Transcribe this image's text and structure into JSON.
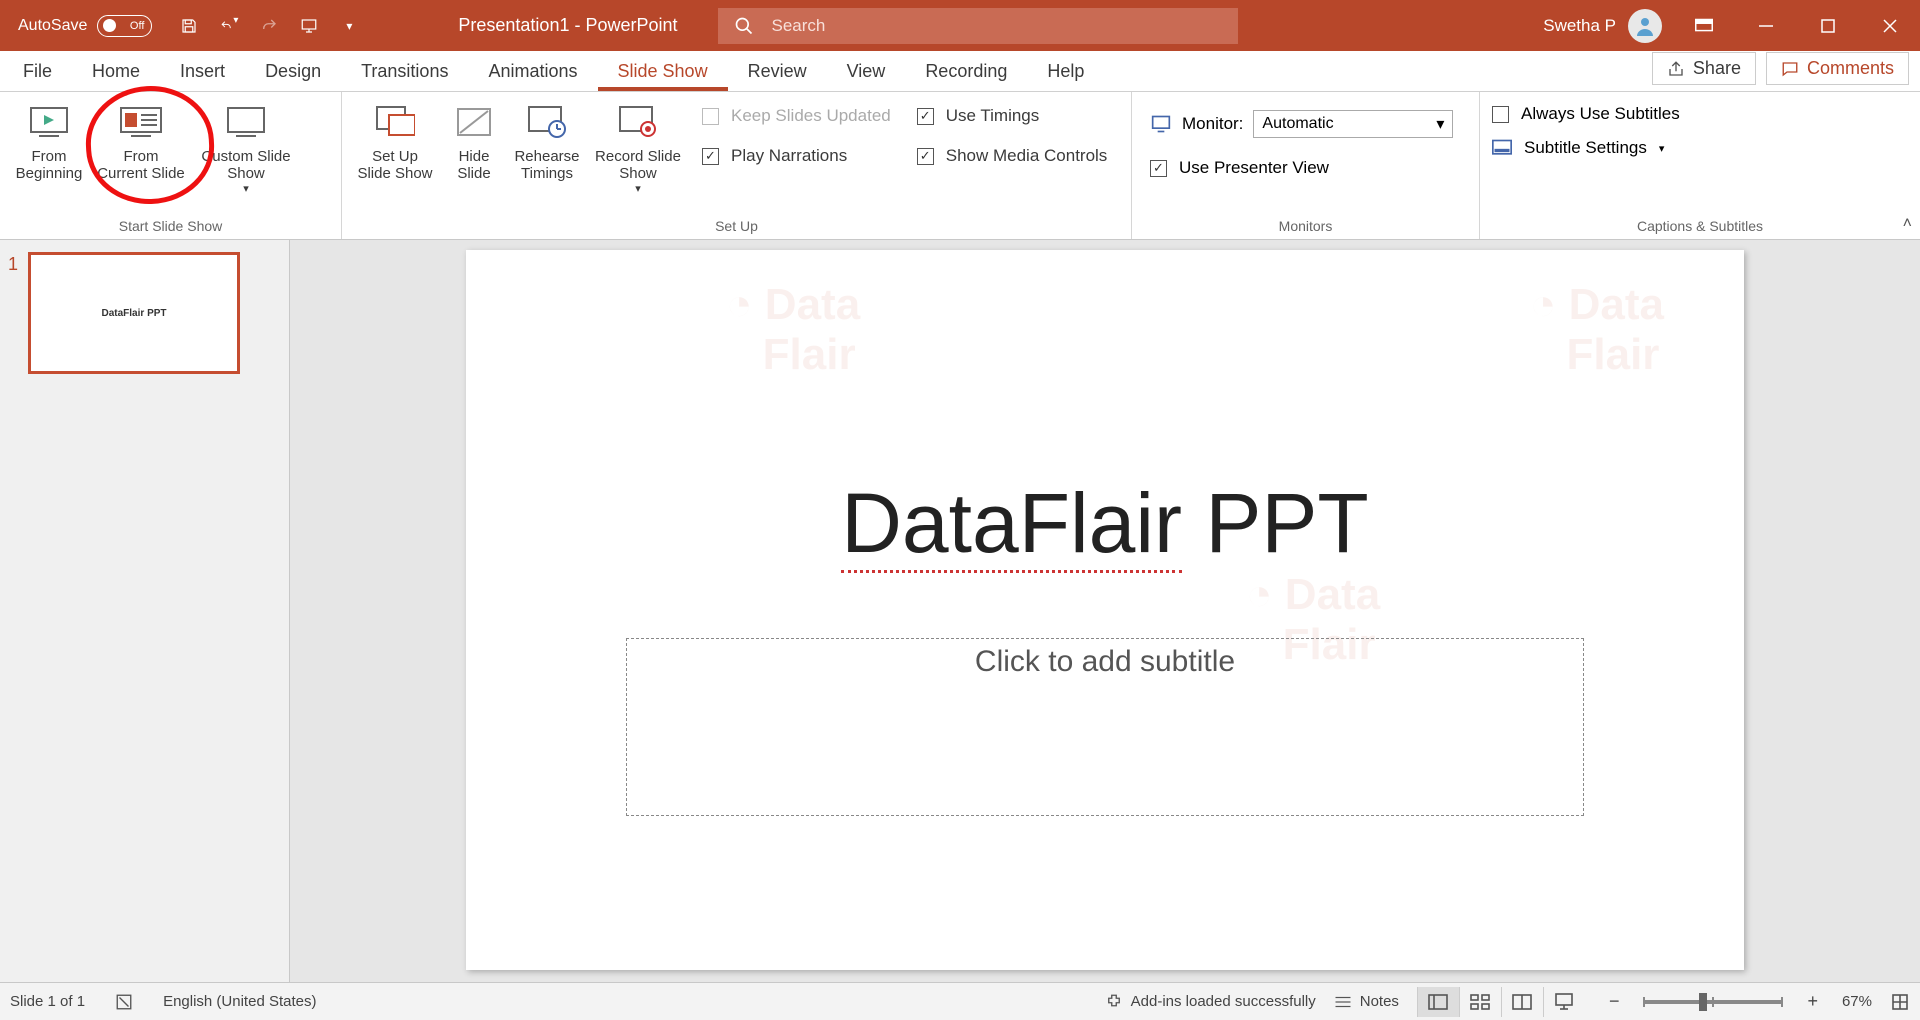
{
  "titlebar": {
    "autosave_label": "AutoSave",
    "autosave_state": "Off",
    "doc_title": "Presentation1  -  PowerPoint",
    "search_placeholder": "Search",
    "user_name": "Swetha P"
  },
  "menu": {
    "tabs": [
      "File",
      "Home",
      "Insert",
      "Design",
      "Transitions",
      "Animations",
      "Slide Show",
      "Review",
      "View",
      "Recording",
      "Help"
    ],
    "active_index": 6,
    "share": "Share",
    "comments": "Comments"
  },
  "ribbon": {
    "start_group": {
      "label": "Start Slide Show",
      "from_beginning": "From\nBeginning",
      "from_current": "From\nCurrent Slide",
      "custom_show": "Custom Slide\nShow"
    },
    "setup_group": {
      "label": "Set Up",
      "setup": "Set Up\nSlide Show",
      "hide": "Hide\nSlide",
      "rehearse": "Rehearse\nTimings",
      "record": "Record Slide\nShow",
      "keep_updated": "Keep Slides Updated",
      "play_narrations": "Play Narrations",
      "use_timings": "Use Timings",
      "show_media": "Show Media Controls"
    },
    "monitors_group": {
      "label": "Monitors",
      "monitor_label": "Monitor:",
      "monitor_value": "Automatic",
      "presenter_view": "Use Presenter View"
    },
    "captions_group": {
      "label": "Captions & Subtitles",
      "always_use": "Always Use Subtitles",
      "subtitle_settings": "Subtitle Settings"
    }
  },
  "thumbs": {
    "slide1_num": "1",
    "slide1_title": "DataFlair PPT"
  },
  "slide": {
    "title_part1": "DataFlair",
    "title_part2": " PPT",
    "subtitle_placeholder": "Click to add subtitle"
  },
  "statusbar": {
    "slide_pos": "Slide 1 of 1",
    "language": "English (United States)",
    "addins": "Add-ins loaded successfully",
    "notes": "Notes",
    "zoom_pct": "67%"
  }
}
